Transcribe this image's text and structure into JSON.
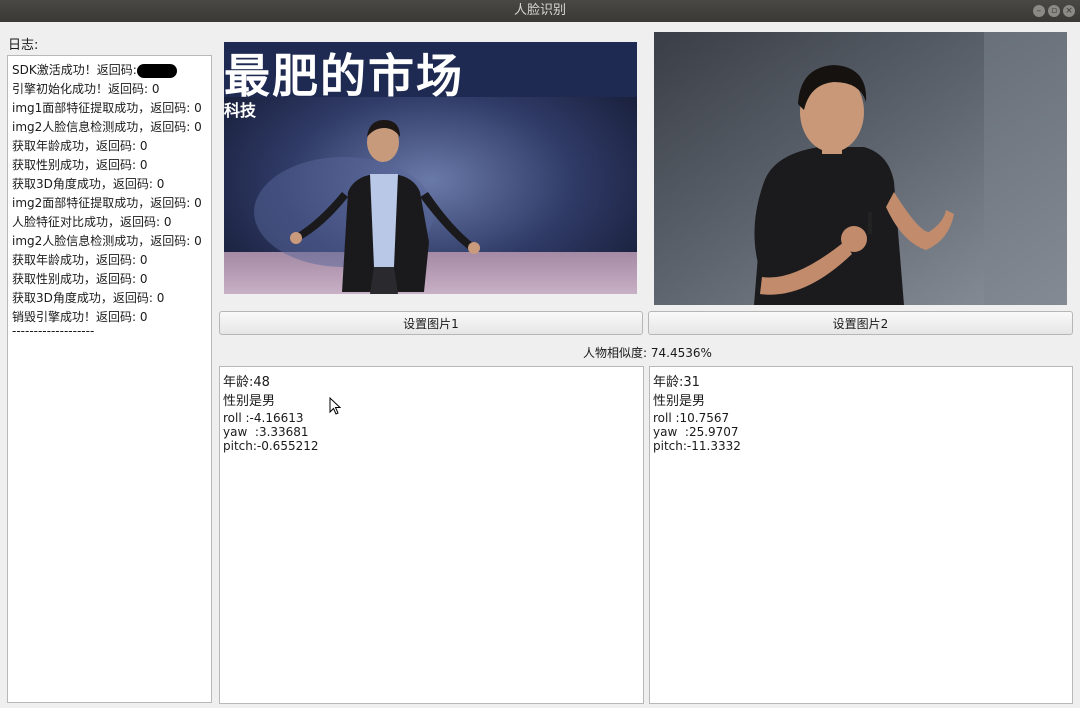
{
  "window": {
    "title": "人脸识别"
  },
  "log": {
    "label": "日志:",
    "lines": [
      "SDK激活成功！返回码:",
      "引擎初始化成功！返回码: 0",
      "img1面部特征提取成功，返回码: 0",
      "img2人脸信息检测成功，返回码: 0",
      "获取年龄成功，返回码: 0",
      "获取性别成功，返回码: 0",
      "获取3D角度成功，返回码: 0",
      "img2面部特征提取成功，返回码: 0",
      "人脸特征对比成功，返回码: 0",
      "img2人脸信息检测成功，返回码: 0",
      "获取年龄成功，返回码: 0",
      "获取性别成功，返回码: 0",
      "获取3D角度成功，返回码: 0",
      "销毁引擎成功！返回码: 0",
      "-------------------"
    ]
  },
  "image1": {
    "banner_text": "最肥的市场",
    "banner_sub": "科技"
  },
  "buttons": {
    "set_image1": "设置图片1",
    "set_image2": "设置图片2"
  },
  "similarity": {
    "label": "人物相似度: 74.4536%"
  },
  "result1": {
    "age": "年龄:48",
    "gender": "性别是男",
    "roll": "roll :-4.16613",
    "yaw": "yaw  :3.33681",
    "pitch": "pitch:-0.655212"
  },
  "result2": {
    "age": "年龄:31",
    "gender": "性别是男",
    "roll": "roll :10.7567",
    "yaw": "yaw  :25.9707",
    "pitch": "pitch:-11.3332"
  }
}
